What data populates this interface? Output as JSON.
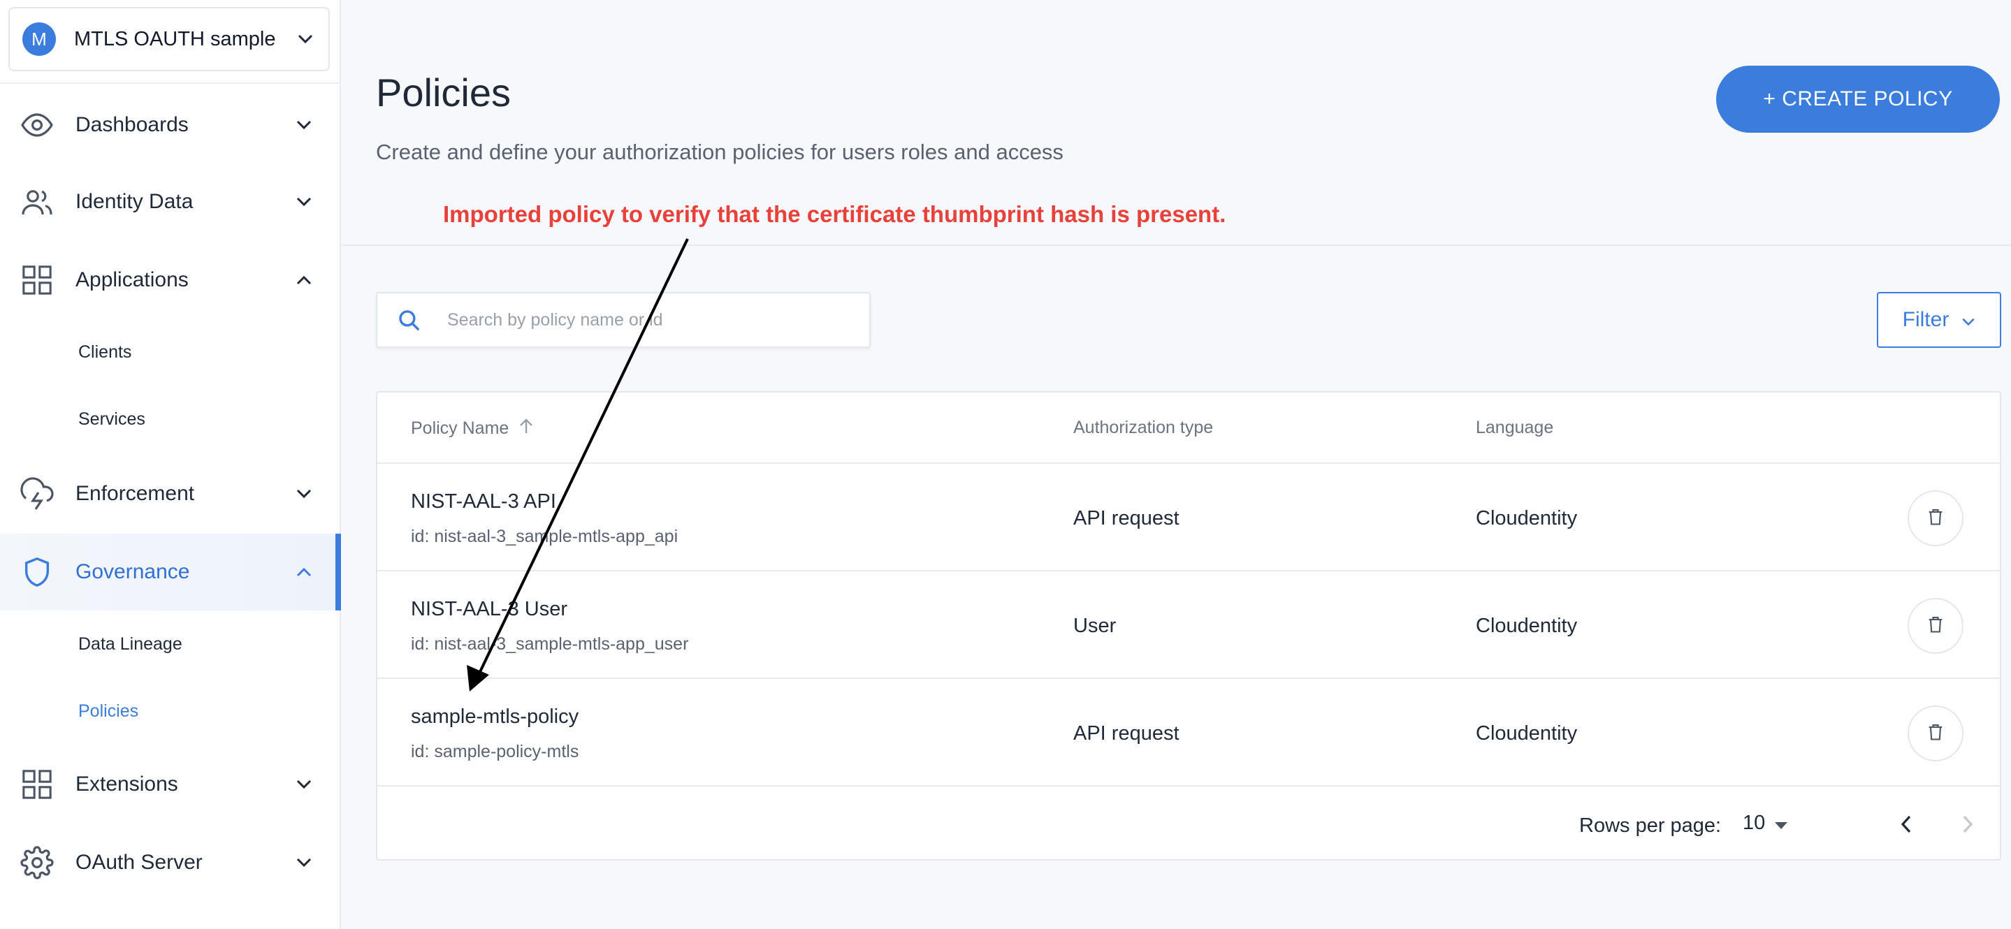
{
  "workspace": {
    "avatar_letter": "M",
    "name": "MTLS OAUTH sample"
  },
  "sidebar": {
    "items": [
      {
        "label": "Dashboards",
        "icon": "eye-icon"
      },
      {
        "label": "Identity Data",
        "icon": "users-icon"
      },
      {
        "label": "Applications",
        "icon": "grid-icon",
        "expanded": true,
        "children": [
          "Clients",
          "Services"
        ]
      },
      {
        "label": "Enforcement",
        "icon": "cloud-lightning-icon"
      },
      {
        "label": "Governance",
        "icon": "shield-icon",
        "expanded": true,
        "active": true,
        "children": [
          "Data Lineage",
          "Policies"
        ]
      },
      {
        "label": "Extensions",
        "icon": "grid-icon"
      },
      {
        "label": "OAuth Server",
        "icon": "gear-icon"
      }
    ],
    "active_child": "Policies"
  },
  "header": {
    "title": "Policies",
    "subtitle": "Create and define your authorization policies for users roles and access",
    "create_button": "+ CREATE POLICY"
  },
  "annotation": "Imported policy to verify that the certificate thumbprint hash is present.",
  "search": {
    "placeholder": "Search by policy name or id",
    "value": ""
  },
  "filter": {
    "label": "Filter"
  },
  "table": {
    "columns": [
      "Policy Name",
      "Authorization type",
      "Language"
    ],
    "rows": [
      {
        "name": "NIST-AAL-3 API",
        "id": "id: nist-aal-3_sample-mtls-app_api",
        "type": "API request",
        "language": "Cloudentity"
      },
      {
        "name": "NIST-AAL-3 User",
        "id": "id: nist-aal-3_sample-mtls-app_user",
        "type": "User",
        "language": "Cloudentity"
      },
      {
        "name": "sample-mtls-policy",
        "id": "id: sample-policy-mtls",
        "type": "API request",
        "language": "Cloudentity"
      }
    ]
  },
  "pagination": {
    "rows_per_page_label": "Rows per page:",
    "rows_per_page": "10"
  },
  "colors": {
    "accent": "#3b7ddd",
    "annotation": "#e8413a",
    "background": "#f6f8fc"
  }
}
